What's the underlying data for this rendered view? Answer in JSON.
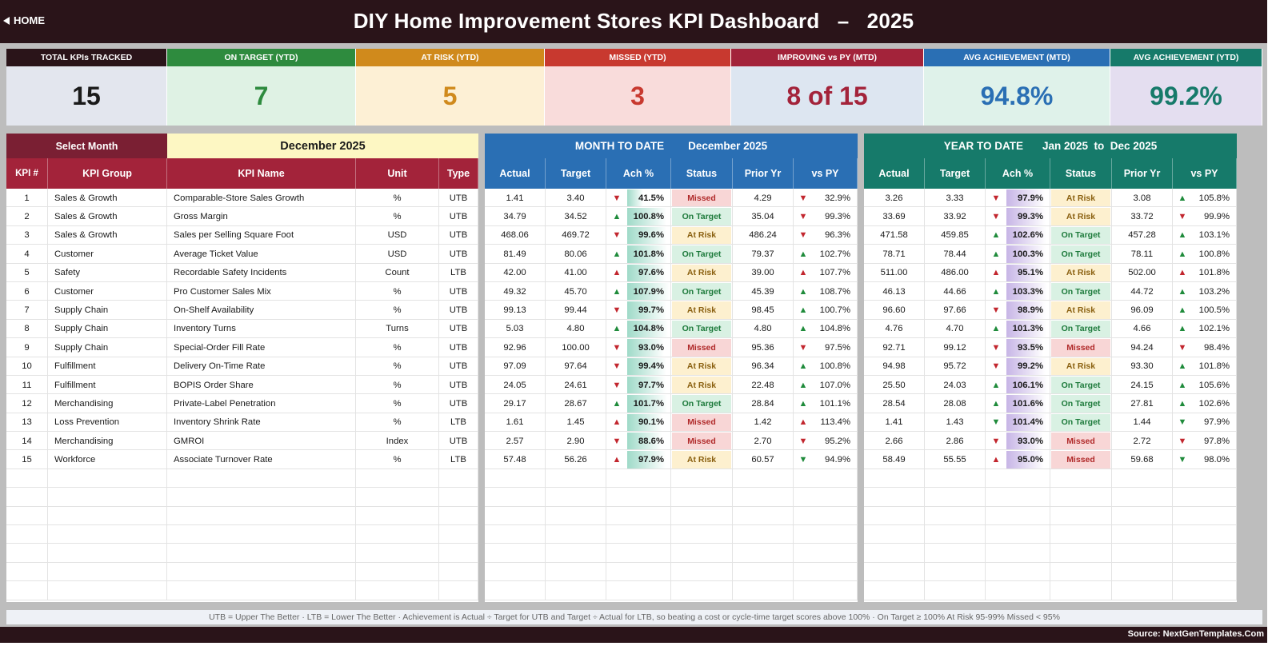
{
  "header": {
    "home_label": "HOME",
    "title": "DIY Home Improvement Stores KPI Dashboard   –   2025"
  },
  "cards": [
    {
      "label": "TOTAL KPIs TRACKED",
      "value": "15",
      "head": "#2a1419",
      "bg": "#e3e6ee",
      "fg": "#1a1a1a"
    },
    {
      "label": "ON TARGET (YTD)",
      "value": "7",
      "head": "#2e8b3e",
      "bg": "#dff2e4",
      "fg": "#2e8b3e"
    },
    {
      "label": "AT RISK (YTD)",
      "value": "5",
      "head": "#d08a1c",
      "bg": "#fdf0d5",
      "fg": "#d08a1c"
    },
    {
      "label": "MISSED (YTD)",
      "value": "3",
      "head": "#c8392f",
      "bg": "#f9dcdb",
      "fg": "#c8392f"
    },
    {
      "label": "IMPROVING vs PY (MTD)",
      "value": "8 of 15",
      "head": "#a3233a",
      "bg": "#dde6f1",
      "fg": "#a3233a"
    },
    {
      "label": "AVG ACHIEVEMENT (MTD)",
      "value": "94.8%",
      "head": "#2a6fb4",
      "bg": "#dff2ea",
      "fg": "#2a6fb4"
    },
    {
      "label": "AVG ACHIEVEMENT (YTD)",
      "value": "99.2%",
      "head": "#167a6a",
      "bg": "#e4def0",
      "fg": "#167a6a"
    }
  ],
  "left_panel": {
    "select_label": "Select Month",
    "selected_month": "December 2025",
    "columns": [
      "KPI #",
      "KPI Group",
      "KPI Name",
      "Unit",
      "Type"
    ]
  },
  "mtd_panel": {
    "title": "MONTH TO DATE",
    "period": "December 2025",
    "columns": [
      "Actual",
      "Target",
      "Ach %",
      "Status",
      "Prior Yr",
      "vs PY"
    ]
  },
  "ytd_panel": {
    "title": "YEAR TO DATE",
    "period": "Jan 2025  to  Dec 2025",
    "columns": [
      "Actual",
      "Target",
      "Ach %",
      "Status",
      "Prior Yr",
      "vs PY"
    ]
  },
  "kpis": [
    {
      "num": "1",
      "group": "Sales & Growth",
      "name": "Comparable-Store Sales Growth",
      "unit": "%",
      "type": "UTB",
      "mtd": {
        "actual": "1.41",
        "target": "3.40",
        "ach_dir": "down",
        "ach": "41.5%",
        "status": "Missed",
        "prior": "4.29",
        "py_dir": "down",
        "vspy": "32.9%"
      },
      "ytd": {
        "actual": "3.26",
        "target": "3.33",
        "ach_dir": "down",
        "ach": "97.9%",
        "status": "At Risk",
        "prior": "3.08",
        "py_dir": "up",
        "vspy": "105.8%"
      }
    },
    {
      "num": "2",
      "group": "Sales & Growth",
      "name": "Gross Margin",
      "unit": "%",
      "type": "UTB",
      "mtd": {
        "actual": "34.79",
        "target": "34.52",
        "ach_dir": "up",
        "ach": "100.8%",
        "status": "On Target",
        "prior": "35.04",
        "py_dir": "down",
        "vspy": "99.3%"
      },
      "ytd": {
        "actual": "33.69",
        "target": "33.92",
        "ach_dir": "down",
        "ach": "99.3%",
        "status": "At Risk",
        "prior": "33.72",
        "py_dir": "down",
        "vspy": "99.9%"
      }
    },
    {
      "num": "3",
      "group": "Sales & Growth",
      "name": "Sales per Selling Square Foot",
      "unit": "USD",
      "type": "UTB",
      "mtd": {
        "actual": "468.06",
        "target": "469.72",
        "ach_dir": "down",
        "ach": "99.6%",
        "status": "At Risk",
        "prior": "486.24",
        "py_dir": "down",
        "vspy": "96.3%"
      },
      "ytd": {
        "actual": "471.58",
        "target": "459.85",
        "ach_dir": "up",
        "ach": "102.6%",
        "status": "On Target",
        "prior": "457.28",
        "py_dir": "up",
        "vspy": "103.1%"
      }
    },
    {
      "num": "4",
      "group": "Customer",
      "name": "Average Ticket Value",
      "unit": "USD",
      "type": "UTB",
      "mtd": {
        "actual": "81.49",
        "target": "80.06",
        "ach_dir": "up",
        "ach": "101.8%",
        "status": "On Target",
        "prior": "79.37",
        "py_dir": "up",
        "vspy": "102.7%"
      },
      "ytd": {
        "actual": "78.71",
        "target": "78.44",
        "ach_dir": "up",
        "ach": "100.3%",
        "status": "On Target",
        "prior": "78.11",
        "py_dir": "up",
        "vspy": "100.8%"
      }
    },
    {
      "num": "5",
      "group": "Safety",
      "name": "Recordable Safety Incidents",
      "unit": "Count",
      "type": "LTB",
      "mtd": {
        "actual": "42.00",
        "target": "41.00",
        "ach_dir": "up_red",
        "ach": "97.6%",
        "status": "At Risk",
        "prior": "39.00",
        "py_dir": "up_red",
        "vspy": "107.7%"
      },
      "ytd": {
        "actual": "511.00",
        "target": "486.00",
        "ach_dir": "up_red",
        "ach": "95.1%",
        "status": "At Risk",
        "prior": "502.00",
        "py_dir": "up_red",
        "vspy": "101.8%"
      }
    },
    {
      "num": "6",
      "group": "Customer",
      "name": "Pro Customer Sales Mix",
      "unit": "%",
      "type": "UTB",
      "mtd": {
        "actual": "49.32",
        "target": "45.70",
        "ach_dir": "up",
        "ach": "107.9%",
        "status": "On Target",
        "prior": "45.39",
        "py_dir": "up",
        "vspy": "108.7%"
      },
      "ytd": {
        "actual": "46.13",
        "target": "44.66",
        "ach_dir": "up",
        "ach": "103.3%",
        "status": "On Target",
        "prior": "44.72",
        "py_dir": "up",
        "vspy": "103.2%"
      }
    },
    {
      "num": "7",
      "group": "Supply Chain",
      "name": "On-Shelf Availability",
      "unit": "%",
      "type": "UTB",
      "mtd": {
        "actual": "99.13",
        "target": "99.44",
        "ach_dir": "down",
        "ach": "99.7%",
        "status": "At Risk",
        "prior": "98.45",
        "py_dir": "up",
        "vspy": "100.7%"
      },
      "ytd": {
        "actual": "96.60",
        "target": "97.66",
        "ach_dir": "down",
        "ach": "98.9%",
        "status": "At Risk",
        "prior": "96.09",
        "py_dir": "up",
        "vspy": "100.5%"
      }
    },
    {
      "num": "8",
      "group": "Supply Chain",
      "name": "Inventory Turns",
      "unit": "Turns",
      "type": "UTB",
      "mtd": {
        "actual": "5.03",
        "target": "4.80",
        "ach_dir": "up",
        "ach": "104.8%",
        "status": "On Target",
        "prior": "4.80",
        "py_dir": "up",
        "vspy": "104.8%"
      },
      "ytd": {
        "actual": "4.76",
        "target": "4.70",
        "ach_dir": "up",
        "ach": "101.3%",
        "status": "On Target",
        "prior": "4.66",
        "py_dir": "up",
        "vspy": "102.1%"
      }
    },
    {
      "num": "9",
      "group": "Supply Chain",
      "name": "Special-Order Fill Rate",
      "unit": "%",
      "type": "UTB",
      "mtd": {
        "actual": "92.96",
        "target": "100.00",
        "ach_dir": "down",
        "ach": "93.0%",
        "status": "Missed",
        "prior": "95.36",
        "py_dir": "down",
        "vspy": "97.5%"
      },
      "ytd": {
        "actual": "92.71",
        "target": "99.12",
        "ach_dir": "down",
        "ach": "93.5%",
        "status": "Missed",
        "prior": "94.24",
        "py_dir": "down",
        "vspy": "98.4%"
      }
    },
    {
      "num": "10",
      "group": "Fulfillment",
      "name": "Delivery On-Time Rate",
      "unit": "%",
      "type": "UTB",
      "mtd": {
        "actual": "97.09",
        "target": "97.64",
        "ach_dir": "down",
        "ach": "99.4%",
        "status": "At Risk",
        "prior": "96.34",
        "py_dir": "up",
        "vspy": "100.8%"
      },
      "ytd": {
        "actual": "94.98",
        "target": "95.72",
        "ach_dir": "down",
        "ach": "99.2%",
        "status": "At Risk",
        "prior": "93.30",
        "py_dir": "up",
        "vspy": "101.8%"
      }
    },
    {
      "num": "11",
      "group": "Fulfillment",
      "name": "BOPIS Order Share",
      "unit": "%",
      "type": "UTB",
      "mtd": {
        "actual": "24.05",
        "target": "24.61",
        "ach_dir": "down",
        "ach": "97.7%",
        "status": "At Risk",
        "prior": "22.48",
        "py_dir": "up",
        "vspy": "107.0%"
      },
      "ytd": {
        "actual": "25.50",
        "target": "24.03",
        "ach_dir": "up",
        "ach": "106.1%",
        "status": "On Target",
        "prior": "24.15",
        "py_dir": "up",
        "vspy": "105.6%"
      }
    },
    {
      "num": "12",
      "group": "Merchandising",
      "name": "Private-Label Penetration",
      "unit": "%",
      "type": "UTB",
      "mtd": {
        "actual": "29.17",
        "target": "28.67",
        "ach_dir": "up",
        "ach": "101.7%",
        "status": "On Target",
        "prior": "28.84",
        "py_dir": "up",
        "vspy": "101.1%"
      },
      "ytd": {
        "actual": "28.54",
        "target": "28.08",
        "ach_dir": "up",
        "ach": "101.6%",
        "status": "On Target",
        "prior": "27.81",
        "py_dir": "up",
        "vspy": "102.6%"
      }
    },
    {
      "num": "13",
      "group": "Loss Prevention",
      "name": "Inventory Shrink Rate",
      "unit": "%",
      "type": "LTB",
      "mtd": {
        "actual": "1.61",
        "target": "1.45",
        "ach_dir": "up_red",
        "ach": "90.1%",
        "status": "Missed",
        "prior": "1.42",
        "py_dir": "up_red",
        "vspy": "113.4%"
      },
      "ytd": {
        "actual": "1.41",
        "target": "1.43",
        "ach_dir": "down_green",
        "ach": "101.4%",
        "status": "On Target",
        "prior": "1.44",
        "py_dir": "down_green",
        "vspy": "97.9%"
      }
    },
    {
      "num": "14",
      "group": "Merchandising",
      "name": "GMROI",
      "unit": "Index",
      "type": "UTB",
      "mtd": {
        "actual": "2.57",
        "target": "2.90",
        "ach_dir": "down",
        "ach": "88.6%",
        "status": "Missed",
        "prior": "2.70",
        "py_dir": "down",
        "vspy": "95.2%"
      },
      "ytd": {
        "actual": "2.66",
        "target": "2.86",
        "ach_dir": "down",
        "ach": "93.0%",
        "status": "Missed",
        "prior": "2.72",
        "py_dir": "down",
        "vspy": "97.8%"
      }
    },
    {
      "num": "15",
      "group": "Workforce",
      "name": "Associate Turnover Rate",
      "unit": "%",
      "type": "LTB",
      "mtd": {
        "actual": "57.48",
        "target": "56.26",
        "ach_dir": "up_red",
        "ach": "97.9%",
        "status": "At Risk",
        "prior": "60.57",
        "py_dir": "down_green",
        "vspy": "94.9%"
      },
      "ytd": {
        "actual": "58.49",
        "target": "55.55",
        "ach_dir": "up_red",
        "ach": "95.0%",
        "status": "Missed",
        "prior": "59.68",
        "py_dir": "down_green",
        "vspy": "98.0%"
      }
    }
  ],
  "footer_note": "UTB = Upper The Better   ·   LTB = Lower The Better   ·   Achievement is Actual ÷ Target for UTB and Target ÷ Actual for LTB, so beating a cost or cycle-time target scores above 100%   ·   On Target ≥ 100%    At Risk 95-99%    Missed < 95%",
  "source": "Source: NextGenTemplates.Com",
  "colors": {
    "left_header": "#7a1f33",
    "left_col_header": "#a3233a",
    "month_bg": "#fdf7c3",
    "mtd_header": "#2a6fb4",
    "ytd_header": "#167a6a",
    "mtd_bar": "#9fdac8",
    "ytd_bar": "#c7b5e6"
  }
}
